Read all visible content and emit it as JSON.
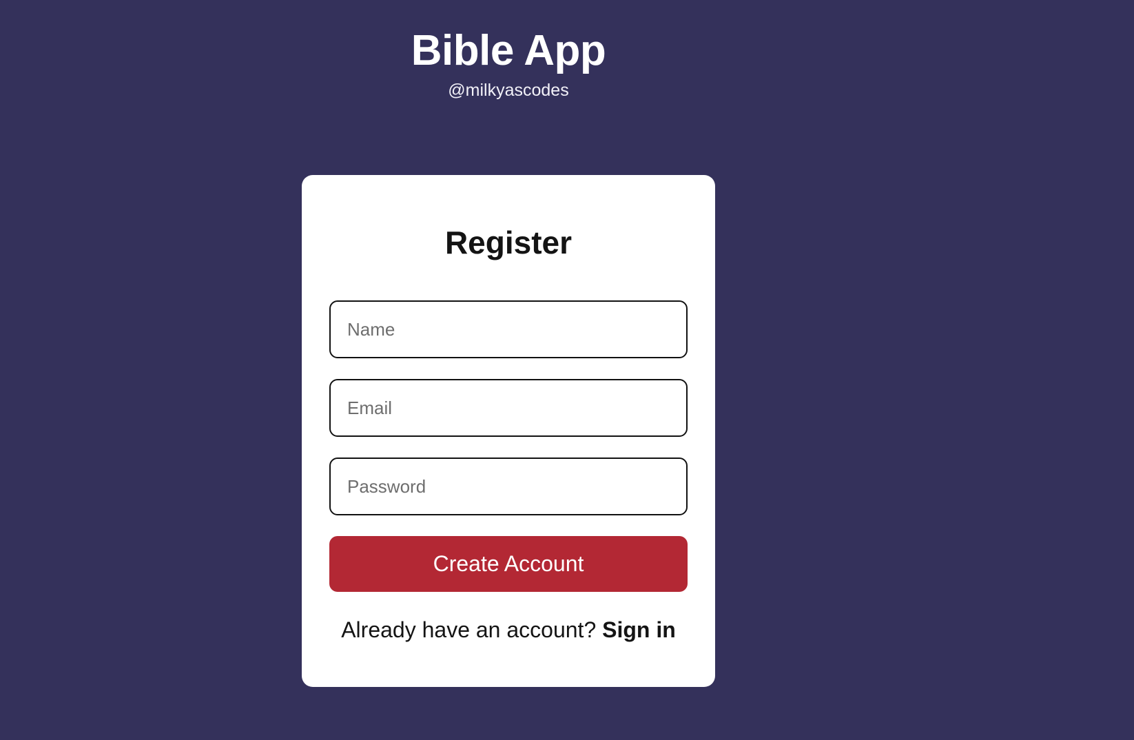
{
  "header": {
    "title": "Bible App",
    "handle": "@milkyascodes"
  },
  "register": {
    "heading": "Register",
    "name_placeholder": "Name",
    "email_placeholder": "Email",
    "password_placeholder": "Password",
    "submit_label": "Create Account",
    "signin_prompt": "Already have an account?",
    "signin_link": "Sign in"
  },
  "colors": {
    "background": "#34315b",
    "card": "#ffffff",
    "accent": "#b32834"
  }
}
